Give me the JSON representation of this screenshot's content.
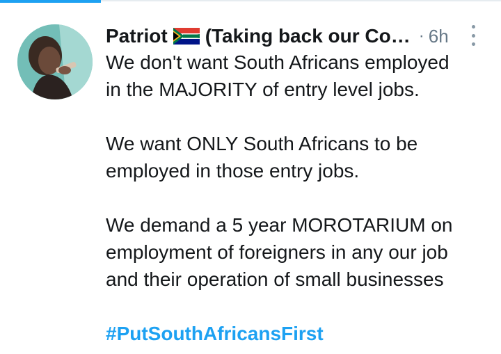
{
  "author": {
    "name": "Patriot",
    "name_suffix": "(Taking back our Co…",
    "flag_icon": "south-africa-flag-icon"
  },
  "meta": {
    "separator": "·",
    "time": "6h"
  },
  "tweet": {
    "para1_line1": "We don't want South Africans employed",
    "para1_line2": "in the MAJORITY of entry level jobs.",
    "para2_line1": "We want ONLY South Africans to be",
    "para2_line2": "employed in those entry jobs.",
    "para3_line1": "We demand a 5 year MOROTARIUM on",
    "para3_line2": "employment of foreigners in any our job",
    "para3_line3": "and their operation of small businesses",
    "hashtag": "#PutSouthAfricansFirst"
  },
  "colors": {
    "accent": "#1da1f2",
    "text": "#14171a",
    "muted": "#657786"
  }
}
